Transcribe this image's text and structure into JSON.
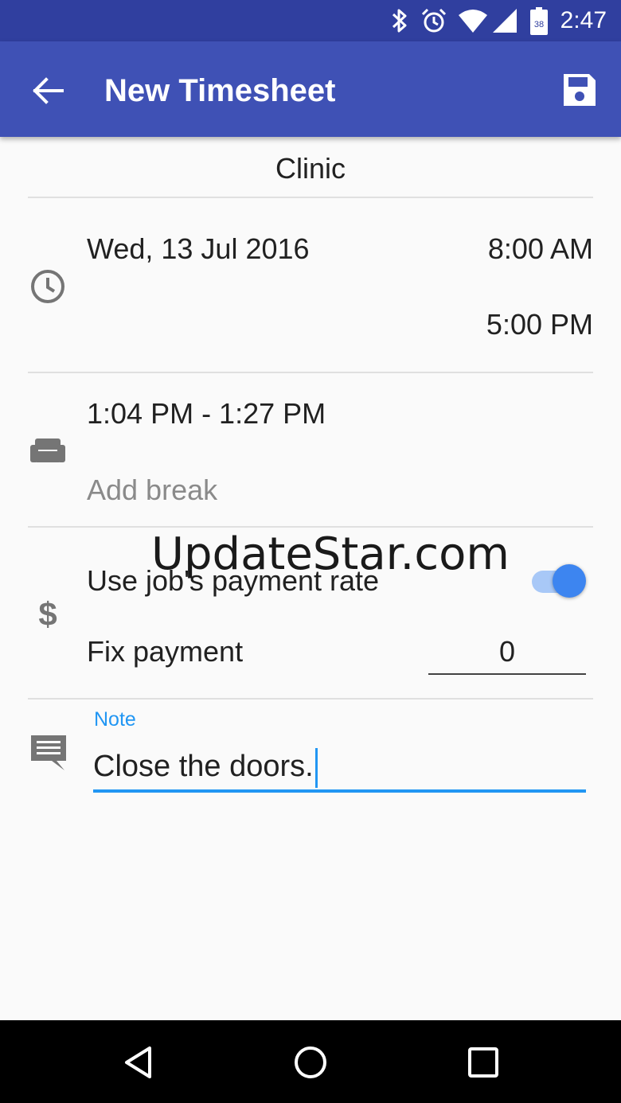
{
  "status_bar": {
    "time": "2:47",
    "battery_level": "38",
    "icons": [
      "bluetooth-icon",
      "alarm-icon",
      "wifi-icon",
      "signal-icon",
      "battery-icon"
    ]
  },
  "app_bar": {
    "title": "New Timesheet",
    "back_icon": "arrow-back-icon",
    "save_icon": "save-icon",
    "color": "#3f51b5"
  },
  "job": "Clinic",
  "time_section": {
    "icon": "clock-icon",
    "date": "Wed, 13 Jul 2016",
    "start_time": "8:00 AM",
    "end_time": "5:00 PM"
  },
  "break_section": {
    "icon": "sofa-icon",
    "break_range": "1:04 PM - 1:27 PM",
    "add_break": "Add break"
  },
  "payment_section": {
    "icon": "dollar-icon",
    "use_rate_label": "Use job's payment rate",
    "use_rate_enabled": true,
    "fix_payment_label": "Fix payment",
    "fix_payment_value": "0"
  },
  "note_section": {
    "icon": "comment-icon",
    "label": "Note",
    "value": "Close the doors.",
    "accent": "#2196f3"
  },
  "watermark": "UpdateStar.com",
  "nav_bar": {
    "icons": [
      "back-triangle-icon",
      "home-circle-icon",
      "recents-square-icon"
    ]
  }
}
